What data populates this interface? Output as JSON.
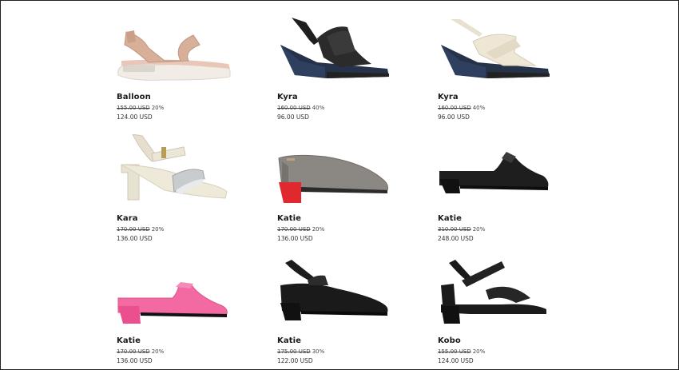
{
  "products": [
    {
      "name": "Balloon",
      "old_price": "155.00 USD",
      "discount": "20%",
      "price": "124.00 USD",
      "color": "#d8b09a"
    },
    {
      "name": "Kyra",
      "old_price": "160.00 USD",
      "discount": "40%",
      "price": "96.00 USD",
      "color": "#2a2a2a"
    },
    {
      "name": "Kyra",
      "old_price": "160.00 USD",
      "discount": "40%",
      "price": "96.00 USD",
      "color": "#efe7d6"
    },
    {
      "name": "Kara",
      "old_price": "170.00 USD",
      "discount": "20%",
      "price": "136.00 USD",
      "color": "#ece6d6"
    },
    {
      "name": "Katie",
      "old_price": "170.00 USD",
      "discount": "20%",
      "price": "136.00 USD",
      "color": "#8a8782"
    },
    {
      "name": "Katie",
      "old_price": "310.00 USD",
      "discount": "20%",
      "price": "248.00 USD",
      "color": "#1c1c1c"
    },
    {
      "name": "Katie",
      "old_price": "170.00 USD",
      "discount": "20%",
      "price": "136.00 USD",
      "color": "#f06aa0"
    },
    {
      "name": "Katie",
      "old_price": "175.00 USD",
      "discount": "30%",
      "price": "122.00 USD",
      "color": "#1a1a1a"
    },
    {
      "name": "Kobo",
      "old_price": "155.00 USD",
      "discount": "20%",
      "price": "124.00 USD",
      "color": "#1a1a1a"
    }
  ]
}
